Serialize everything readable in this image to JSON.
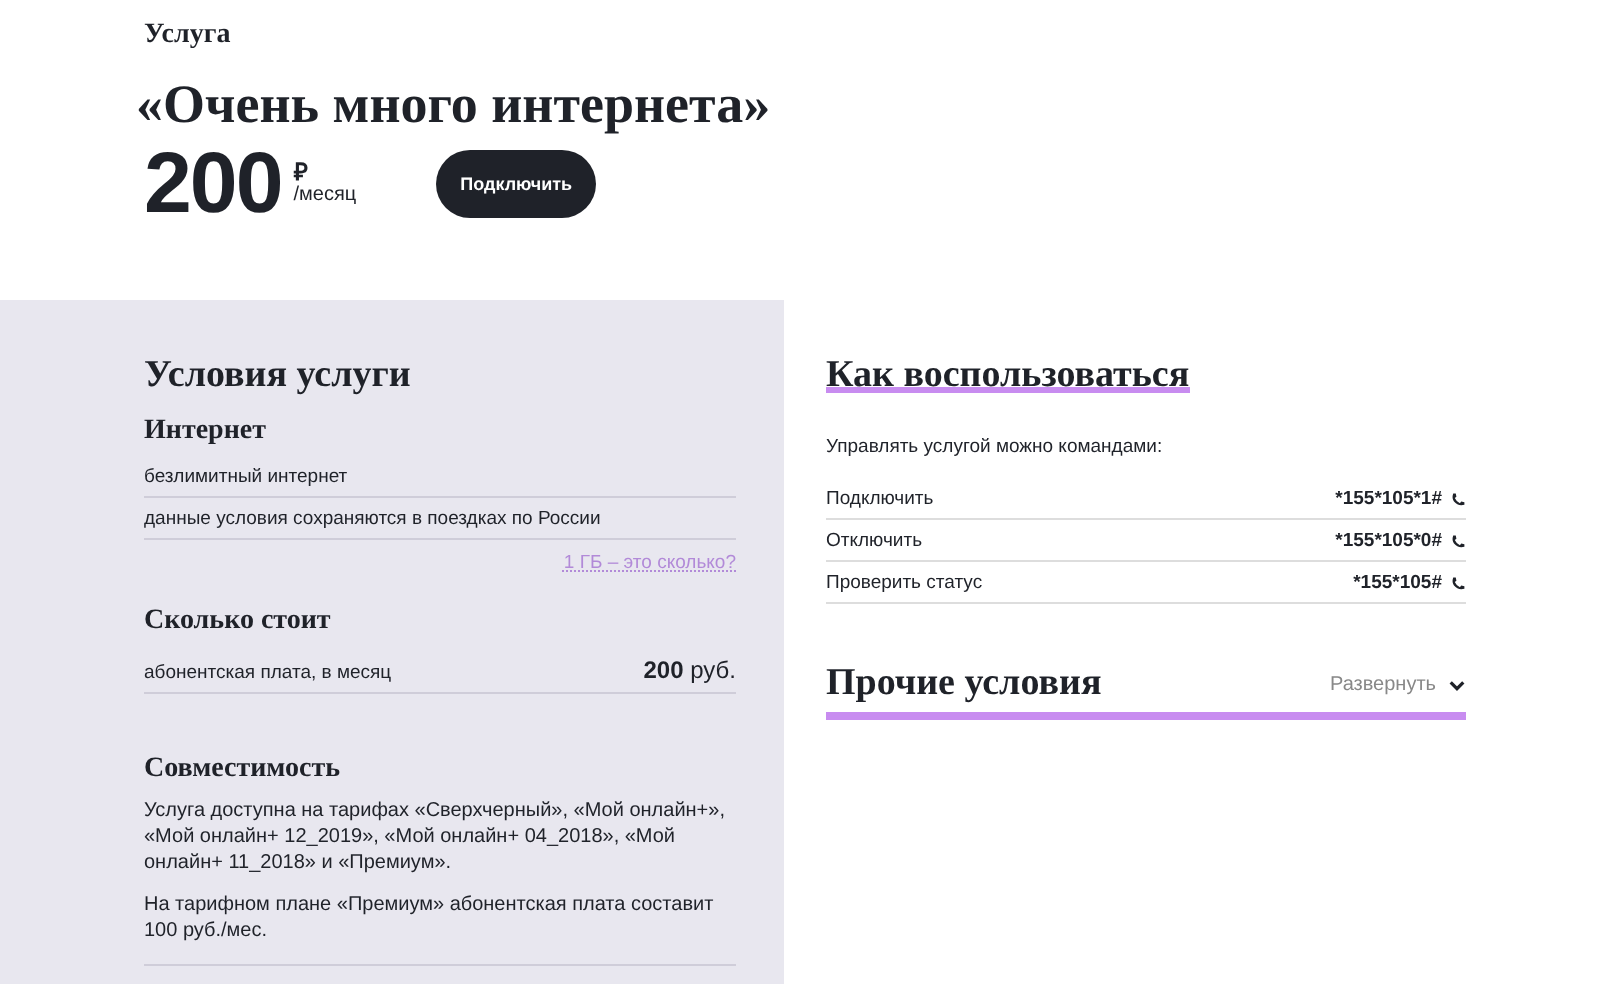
{
  "header": {
    "kicker": "Услуга",
    "title": "«Очень много интернета»",
    "price": "200",
    "currency": "₽",
    "period": "/месяц",
    "button": "Подключить"
  },
  "conditions": {
    "title": "Условия услуги",
    "sections": [
      {
        "title": "Интернет",
        "rows": [
          {
            "text": "безлимитный интернет"
          },
          {
            "text": "данные условия сохраняются в поездках по России"
          }
        ],
        "link": "1 ГБ – это сколько?"
      },
      {
        "title": "Сколько стоит",
        "rows": [
          {
            "text": "абонентская плата, в месяц",
            "value": "**200** руб."
          }
        ]
      },
      {
        "title": "Совместимость",
        "paragraphs": [
          "Услуга доступна на тарифах «Сверхчерный», «Мой онлайн+», «Мой онлайн+ 12_2019», «Мой онлайн+ 04_2018», «Мой онлайн+ 11_2018» и «Премиум».",
          "На тарифном плане «Премиум» абонентская плата составит 100 руб./мес."
        ]
      }
    ]
  },
  "usage": {
    "title": "Как воспользоваться",
    "intro": "Управлять услугой можно командами:",
    "commands": [
      {
        "label": "Подключить",
        "code": "*155*105*1#"
      },
      {
        "label": "Отключить",
        "code": "*155*105*0#"
      },
      {
        "label": "Проверить статус",
        "code": "*155*105#"
      }
    ]
  },
  "other": {
    "title": "Прочие условия",
    "toggle": "Развернуть",
    "expanded": false
  }
}
